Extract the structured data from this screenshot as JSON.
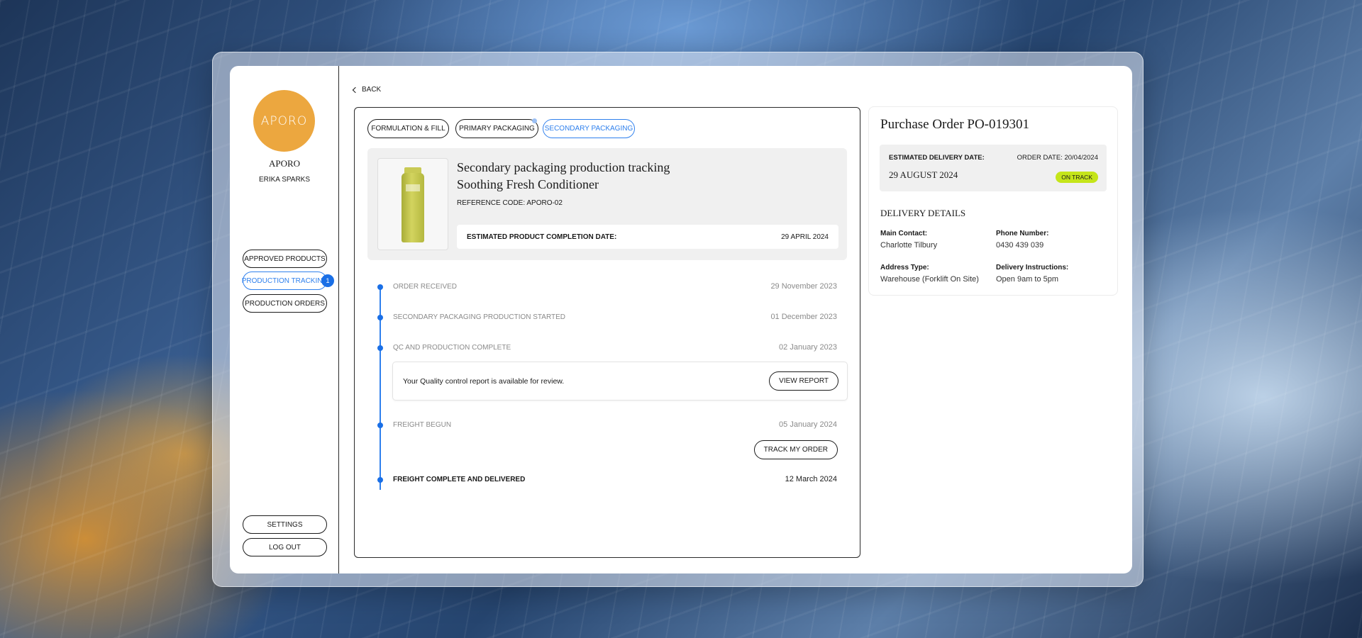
{
  "sidebar": {
    "logo_text": "APORO",
    "company": "APORO",
    "user": "ERIKA SPARKS",
    "nav": [
      {
        "label": "APPROVED PRODUCTS"
      },
      {
        "label": "PRODUCTION TRACKING",
        "badge": "1"
      },
      {
        "label": "PRODUCTION ORDERS"
      }
    ],
    "settings": "SETTINGS",
    "logout": "LOG OUT"
  },
  "back_label": "BACK",
  "tabs": [
    {
      "label": "FORMULATION & FILL"
    },
    {
      "label": "PRIMARY PACKAGING"
    },
    {
      "label": "SECONDARY PACKAGING",
      "active": true
    }
  ],
  "product": {
    "title_line1": "Secondary packaging production tracking",
    "title_line2": "Soothing Fresh Conditioner",
    "reference": "REFERENCE CODE: APORO-02",
    "est_label": "ESTIMATED PRODUCT COMPLETION DATE:",
    "est_date": "29 APRIL 2024"
  },
  "timeline": [
    {
      "label": "ORDER RECEIVED",
      "date": "29 November 2023"
    },
    {
      "label": "SECONDARY PACKAGING PRODUCTION STARTED",
      "date": "01 December 2023"
    },
    {
      "label": "QC AND PRODUCTION COMPLETE",
      "date": "02 January 2023"
    },
    {
      "label": "FREIGHT BEGUN",
      "date": "05 January 2024"
    },
    {
      "label": "FREIGHT COMPLETE AND DELIVERED",
      "date": "12 March 2024"
    }
  ],
  "report": {
    "text": "Your Quality control report is available for review.",
    "button": "VIEW REPORT"
  },
  "track_button": "TRACK MY ORDER",
  "purchase_order": {
    "title": "Purchase Order PO-019301",
    "est_delivery_label": "ESTIMATED DELIVERY DATE:",
    "est_delivery_date": "29 AUGUST 2024",
    "order_date": "ORDER DATE: 20/04/2024",
    "status": "ON TRACK",
    "status_color": "#c5e51a",
    "delivery_heading": "DELIVERY DETAILS",
    "main_contact_label": "Main Contact:",
    "main_contact": "Charlotte Tilbury",
    "phone_label": "Phone Number:",
    "phone": "0430 439 039",
    "address_label": "Address Type:",
    "address": "Warehouse (Forklift On Site)",
    "instructions_label": "Delivery Instructions:",
    "instructions": "Open 9am to 5pm"
  },
  "colors": {
    "accent": "#2f80ed",
    "logo": "#eca73f"
  }
}
